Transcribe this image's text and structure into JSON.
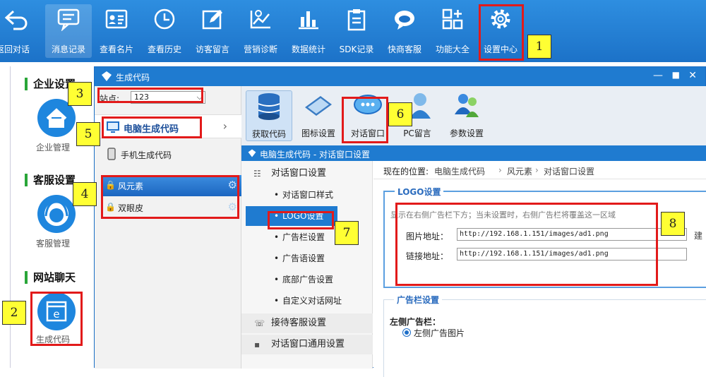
{
  "toolbar": {
    "items": [
      {
        "label": "返回对话",
        "icon": "back-arrow-icon"
      },
      {
        "label": "消息记录",
        "icon": "chat-bubble-icon"
      },
      {
        "label": "查看名片",
        "icon": "id-card-icon"
      },
      {
        "label": "查看历史",
        "icon": "clock-icon"
      },
      {
        "label": "访客留言",
        "icon": "edit-icon"
      },
      {
        "label": "营销诊断",
        "icon": "chart-line-icon"
      },
      {
        "label": "数据统计",
        "icon": "bar-chart-icon"
      },
      {
        "label": "SDK记录",
        "icon": "clipboard-icon"
      },
      {
        "label": "快商客服",
        "icon": "bubble-face-icon"
      },
      {
        "label": "功能大全",
        "icon": "grid-plus-icon"
      },
      {
        "label": "设置中心",
        "icon": "gear-icon"
      }
    ]
  },
  "leftbar": {
    "sections": [
      {
        "title": "企业设置",
        "item_label": "企业管理"
      },
      {
        "title": "客服设置",
        "item_label": "客服管理"
      },
      {
        "title": "网站聊天",
        "item_label": "生成代码"
      }
    ]
  },
  "dialog": {
    "title": "生成代码",
    "controls": [
      "—",
      "■",
      "✕"
    ],
    "site_label": "站点:",
    "site_value": "123",
    "nav_pc": "电脑生成代码",
    "nav_mobile": "手机生成代码",
    "elements": [
      "风元素",
      "双眼皮"
    ],
    "tools": [
      "获取代码",
      "图标设置",
      "对话窗口",
      "PC留言",
      "参数设置"
    ],
    "subpanel_title": "电脑生成代码 - 对话窗口设置",
    "menu": {
      "header": "对话窗口设置",
      "items": [
        "对话窗口样式",
        "LOGO设置",
        "广告栏设置",
        "广告语设置",
        "底部广告设置",
        "自定义对话网址"
      ],
      "footer_items": [
        "接待客服设置",
        "对话窗口通用设置"
      ]
    },
    "breadcrumb": {
      "prefix": "现在的位置:",
      "parts": [
        "电脑生成代码",
        "风元素",
        "对话窗口设置"
      ]
    },
    "logo": {
      "title": "LOGO设置",
      "desc": "显示在右侧广告栏下方；当未设置时，右侧广告栏将覆盖这一区域",
      "image_label": "图片地址：",
      "image_value": "http://192.168.1.151/images/ad1.png",
      "link_label": "链接地址：",
      "link_value": "http://192.168.1.151/images/ad1.png",
      "cut_text": "建"
    },
    "ad": {
      "title": "广告栏设置",
      "left_label": "左侧广告栏：",
      "left_option": "左侧广告图片"
    }
  },
  "annotations": [
    "1",
    "2",
    "3",
    "4",
    "5",
    "6",
    "7",
    "8"
  ]
}
